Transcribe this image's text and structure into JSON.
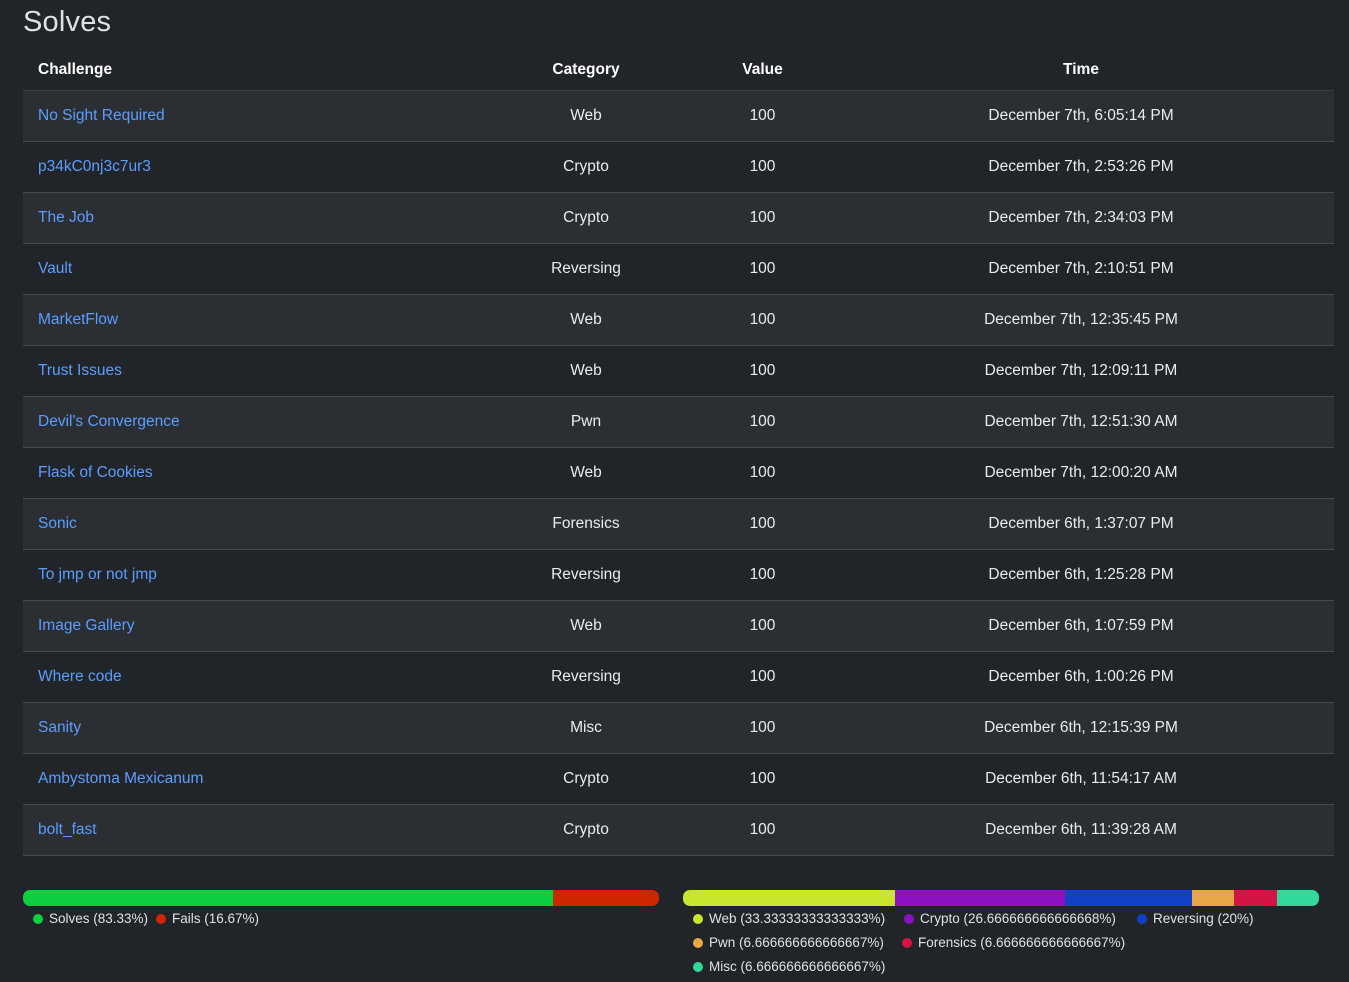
{
  "page": {
    "title": "Solves"
  },
  "table": {
    "headers": {
      "challenge": "Challenge",
      "category": "Category",
      "value": "Value",
      "time": "Time"
    },
    "rows": [
      {
        "challenge": "No Sight Required",
        "category": "Web",
        "value": "100",
        "time": "December 7th, 6:05:14 PM"
      },
      {
        "challenge": "p34kC0nj3c7ur3",
        "category": "Crypto",
        "value": "100",
        "time": "December 7th, 2:53:26 PM"
      },
      {
        "challenge": "The Job",
        "category": "Crypto",
        "value": "100",
        "time": "December 7th, 2:34:03 PM"
      },
      {
        "challenge": "Vault",
        "category": "Reversing",
        "value": "100",
        "time": "December 7th, 2:10:51 PM"
      },
      {
        "challenge": "MarketFlow",
        "category": "Web",
        "value": "100",
        "time": "December 7th, 12:35:45 PM"
      },
      {
        "challenge": "Trust Issues",
        "category": "Web",
        "value": "100",
        "time": "December 7th, 12:09:11 PM"
      },
      {
        "challenge": "Devil's Convergence",
        "category": "Pwn",
        "value": "100",
        "time": "December 7th, 12:51:30 AM"
      },
      {
        "challenge": "Flask of Cookies",
        "category": "Web",
        "value": "100",
        "time": "December 7th, 12:00:20 AM"
      },
      {
        "challenge": "Sonic",
        "category": "Forensics",
        "value": "100",
        "time": "December 6th, 1:37:07 PM"
      },
      {
        "challenge": "To jmp or not jmp",
        "category": "Reversing",
        "value": "100",
        "time": "December 6th, 1:25:28 PM"
      },
      {
        "challenge": "Image Gallery",
        "category": "Web",
        "value": "100",
        "time": "December 6th, 1:07:59 PM"
      },
      {
        "challenge": "Where code",
        "category": "Reversing",
        "value": "100",
        "time": "December 6th, 1:00:26 PM"
      },
      {
        "challenge": "Sanity",
        "category": "Misc",
        "value": "100",
        "time": "December 6th, 12:15:39 PM"
      },
      {
        "challenge": "Ambystoma Mexicanum",
        "category": "Crypto",
        "value": "100",
        "time": "December 6th, 11:54:17 AM"
      },
      {
        "challenge": "bolt_fast",
        "category": "Crypto",
        "value": "100",
        "time": "December 6th, 11:39:28 AM"
      }
    ]
  },
  "colors": {
    "link": "#5c9dff",
    "background": "#212529",
    "row_stripe": "#2b2f34"
  },
  "solve_percentages": {
    "segments": [
      {
        "label": "Solves",
        "percent": 83.33,
        "legend": "Solves (83.33%)",
        "color": "#0ccf3f"
      },
      {
        "label": "Fails",
        "percent": 16.67,
        "legend": "Fails (16.67%)",
        "color": "#cf2600"
      }
    ]
  },
  "category_breakdown": {
    "segments": [
      {
        "label": "Web",
        "percent": 33.33333333333333,
        "legend": "Web (33.33333333333333%)",
        "color": "#c9e62c"
      },
      {
        "label": "Crypto",
        "percent": 26.666666666666668,
        "legend": "Crypto (26.666666666666668%)",
        "color": "#8c11c2"
      },
      {
        "label": "Reversing",
        "percent": 20,
        "legend": "Reversing (20%)",
        "color": "#1240c7"
      },
      {
        "label": "Pwn",
        "percent": 6.666666666666667,
        "legend": "Pwn (6.666666666666667%)",
        "color": "#e8a745"
      },
      {
        "label": "Forensics",
        "percent": 6.666666666666667,
        "legend": "Forensics (6.666666666666667%)",
        "color": "#d41444"
      },
      {
        "label": "Misc",
        "percent": 6.666666666666667,
        "legend": "Misc (6.666666666666667%)",
        "color": "#33d99b"
      }
    ]
  }
}
